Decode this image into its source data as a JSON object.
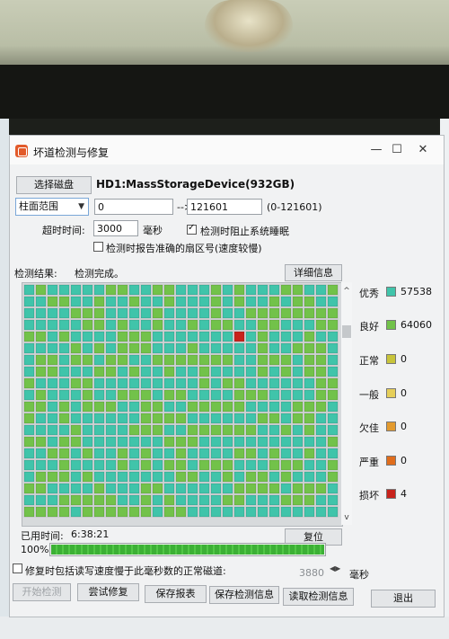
{
  "window": {
    "title": "坏道检测与修复",
    "minimize_symbol": "—",
    "maximize_symbol": "☐",
    "close_symbol": "✕"
  },
  "toolbar": {
    "select_disk_label": "选择磁盘",
    "disk_name": "HD1:MassStorageDevice(932GB)"
  },
  "range": {
    "mode_value": "柱面范围",
    "start_value": "0",
    "arrow": "-->",
    "end_value": "121601",
    "hint": "(0-121601)"
  },
  "timeout": {
    "label": "超时时间:",
    "value": "3000",
    "unit": "毫秒"
  },
  "options": {
    "prevent_sleep_label": "检测时阻止系统睡眠",
    "prevent_sleep_checked": true,
    "report_exact_sector_label": "检测时报告准确的扇区号(速度较慢)",
    "report_exact_sector_checked": false
  },
  "result": {
    "label": "检测结果:",
    "status": "检测完成。",
    "details_button": "详细信息"
  },
  "legend": [
    {
      "name": "优秀",
      "color": "#40c4aa",
      "count": "57538"
    },
    {
      "name": "良好",
      "color": "#72c24a",
      "count": "64060"
    },
    {
      "name": "正常",
      "color": "#c8c43a",
      "count": "0"
    },
    {
      "name": "一般",
      "color": "#e6cf59",
      "count": "0"
    },
    {
      "name": "欠佳",
      "color": "#e39a2e",
      "count": "0"
    },
    {
      "name": "严重",
      "color": "#e06d1c",
      "count": "0"
    },
    {
      "name": "损坏",
      "color": "#c8231c",
      "count": "4"
    }
  ],
  "elapsed": {
    "label": "已用时间:",
    "value": "6:38:21",
    "reset_button": "复位"
  },
  "progress": {
    "percent_text": "100%",
    "fraction": 1.0
  },
  "repair_option": {
    "label": "修复时包括读写速度慢于此毫秒数的正常磁道:",
    "value": "3880",
    "unit": "毫秒",
    "checked": false
  },
  "buttons": {
    "start": "开始检测",
    "try_repair": "尝试修复",
    "save_report": "保存报表",
    "save_detect_info": "保存检测信息",
    "read_detect_info": "读取检测信息",
    "exit": "退出"
  },
  "colors": {
    "excellent": "#40c4aa",
    "good": "#72c24a",
    "damaged": "#c8231c"
  }
}
